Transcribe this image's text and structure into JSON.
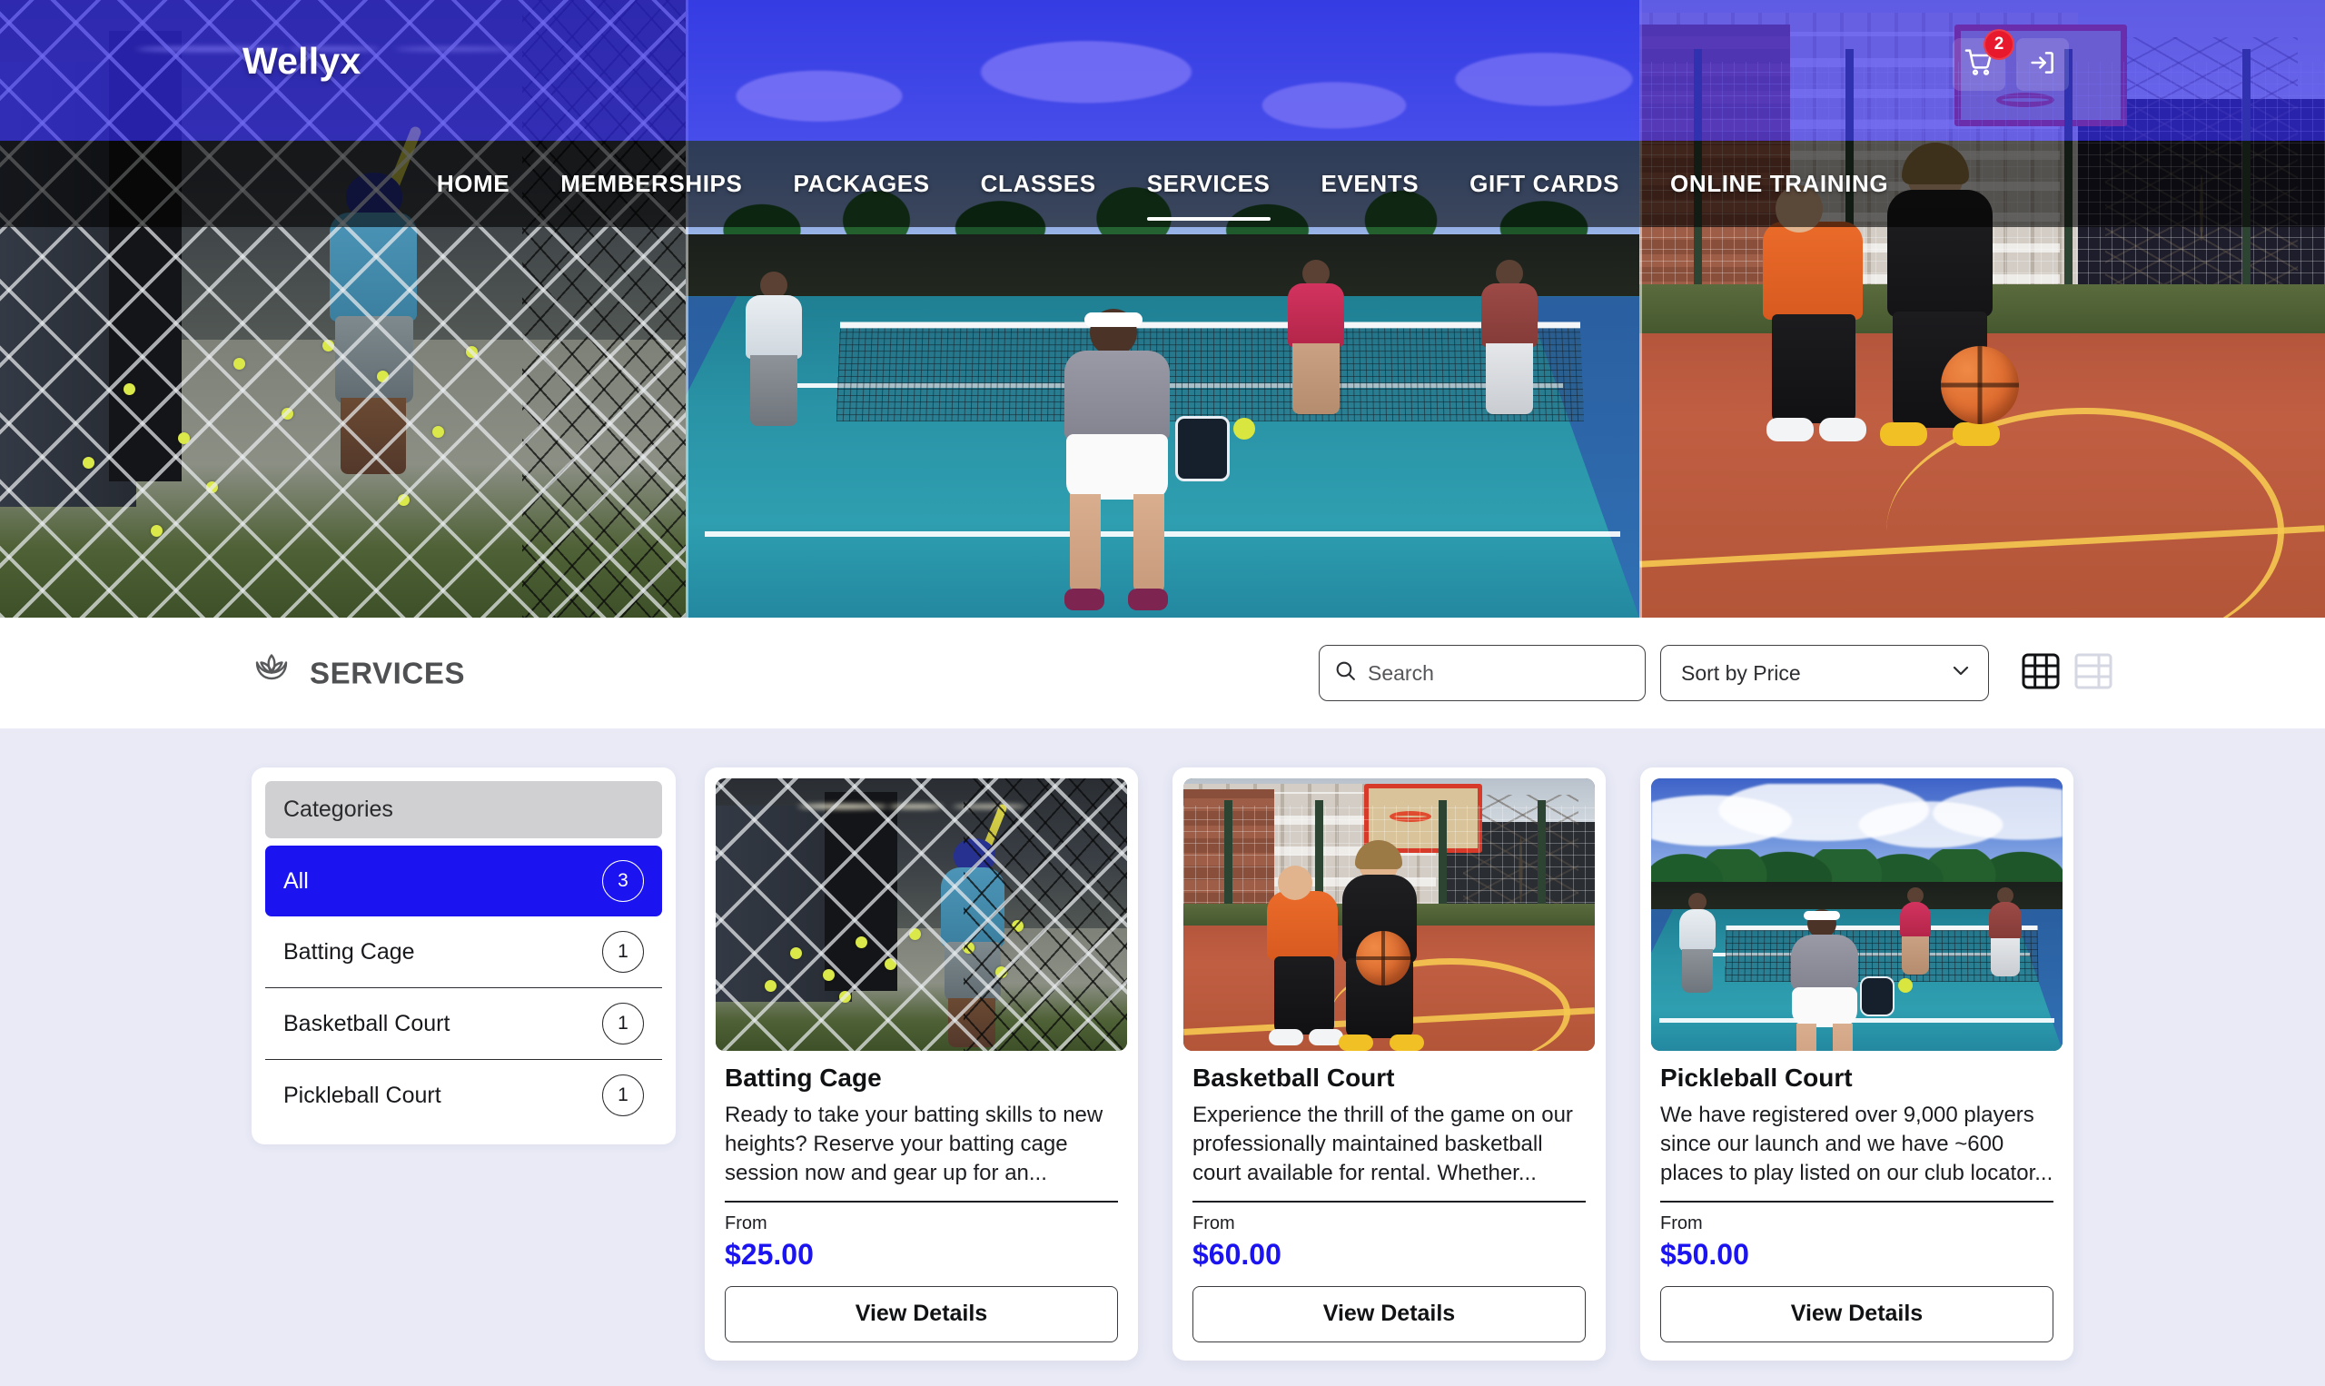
{
  "header": {
    "logo": "Wellyx",
    "cart_badge": "2",
    "cart_icon": "shopping-cart-icon",
    "login_icon": "sign-in-icon",
    "nav": [
      {
        "label": "HOME",
        "active": false
      },
      {
        "label": "MEMBERSHIPS",
        "active": false
      },
      {
        "label": "PACKAGES",
        "active": false
      },
      {
        "label": "CLASSES",
        "active": false
      },
      {
        "label": "SERVICES",
        "active": true
      },
      {
        "label": "EVENTS",
        "active": false
      },
      {
        "label": "GIFT CARDS",
        "active": false
      },
      {
        "label": "ONLINE TRAINING",
        "active": false
      }
    ]
  },
  "toolbar": {
    "page_title": "SERVICES",
    "title_icon": "lotus-icon",
    "search": {
      "value": "",
      "placeholder": "Search",
      "icon": "search-icon"
    },
    "sort": {
      "selected": "Sort by Price",
      "chevron_icon": "chevron-down-icon"
    },
    "views": [
      {
        "name": "grid-view",
        "icon": "grid-icon",
        "active": true
      },
      {
        "name": "list-view",
        "icon": "table-list-icon",
        "active": false
      }
    ]
  },
  "sidebar": {
    "heading": "Categories",
    "items": [
      {
        "label": "All",
        "count": "3",
        "active": true
      },
      {
        "label": "Batting Cage",
        "count": "1",
        "active": false
      },
      {
        "label": "Basketball Court",
        "count": "1",
        "active": false
      },
      {
        "label": "Pickleball Court",
        "count": "1",
        "active": false
      }
    ]
  },
  "cards": [
    {
      "title": "Batting Cage",
      "description": "Ready to take your batting skills to new heights? Reserve your batting cage session now and gear up for an...",
      "from_label": "From",
      "price": "$25.00",
      "button": "View Details",
      "image_alt": "batting-cage-photo"
    },
    {
      "title": "Basketball Court",
      "description": "Experience the thrill of the game on our professionally maintained basketball court available for rental. Whether...",
      "from_label": "From",
      "price": "$60.00",
      "button": "View Details",
      "image_alt": "basketball-court-photo"
    },
    {
      "title": "Pickleball Court",
      "description": "We have registered over 9,000 players since our launch and we have ~600 places to play listed on our club locator...",
      "from_label": "From",
      "price": "$50.00",
      "button": "View Details",
      "image_alt": "pickleball-court-photo"
    }
  ],
  "colors": {
    "accent_blue": "#1b14f0",
    "hero_overlay_blue": "#3128f0",
    "badge_red": "#e8192c",
    "page_background": "#e9eaf6",
    "category_header_gray": "#d0d0d2"
  }
}
